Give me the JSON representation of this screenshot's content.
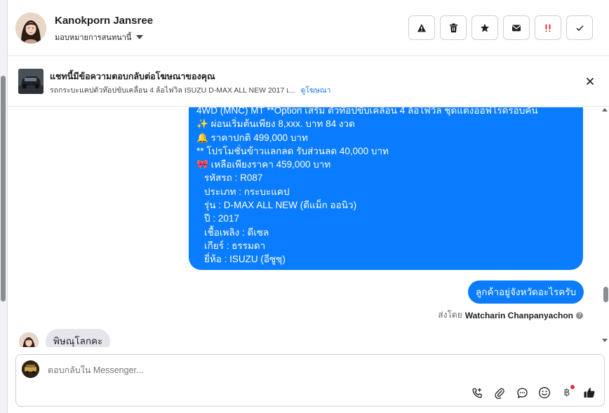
{
  "header": {
    "name": "Kanokporn Jansree",
    "assign_label": "มอบหมายการสนทนานี้",
    "actions": [
      {
        "name": "report",
        "icon": "warning-icon"
      },
      {
        "name": "delete",
        "icon": "trash-icon"
      },
      {
        "name": "star",
        "icon": "star-icon"
      },
      {
        "name": "mark-unread",
        "icon": "envelope-icon"
      },
      {
        "name": "follow-up",
        "icon": "exclamation-icon"
      },
      {
        "name": "done",
        "icon": "check-icon"
      }
    ]
  },
  "ad": {
    "title": "แชทนี้มีข้อความตอบกลับต่อโฆษณาของคุณ",
    "subtitle": "รถกระบะแคปตัวท๊อปขับเคลื่อน 4 ล้อไฟวิล ISUZU D-MAX ALL NEW 2017 เ...",
    "link": "ดูโฆษณา"
  },
  "messages": {
    "long_lines": [
      "4WD (MNC) MT **Option เสริม ตัวท๊อปขับเคลื่อน 4 ล้อไฟวิล ชุดแต่งออฟโรดรอบคัน",
      "✨  ผ่อนเริ่มต้นเพียง 8,xxx. บาท 84 งวด",
      "🔔   ราคาปกติ 499,000 บาท",
      "** โปรโมชั่นข้าวแลกลด รับส่วนลด 40,000 บาท",
      "🎀  เหลือเพียงราคา 459,000 บาท",
      "รหัสรถ : R087",
      "ประเภท : กระบะแคป",
      "รุ่น : D-MAX ALL NEW (ดีแม็ก ออนิว)",
      "ปี : 2017",
      "เชื้อเพลิง : ดีเซล",
      "เกียร์ : ธรรมดา",
      "ยี่ห้อ : ISUZU (อีซูซุ)"
    ],
    "short_out": "ลูกค้าอยู่จังหวัดอะไรครับ",
    "sent_by_prefix": "ส่งโดย",
    "sent_by_name": "Watcharin Chanpanyachon",
    "incoming": "พิษณุโลกคะ"
  },
  "composer": {
    "placeholder": "ตอบกลับใน Messenger...",
    "tools": [
      "call-add-icon",
      "attachment-icon",
      "chat-bubble-icon",
      "emoji-icon",
      "baht-icon",
      "thumbs-up-icon"
    ]
  }
}
